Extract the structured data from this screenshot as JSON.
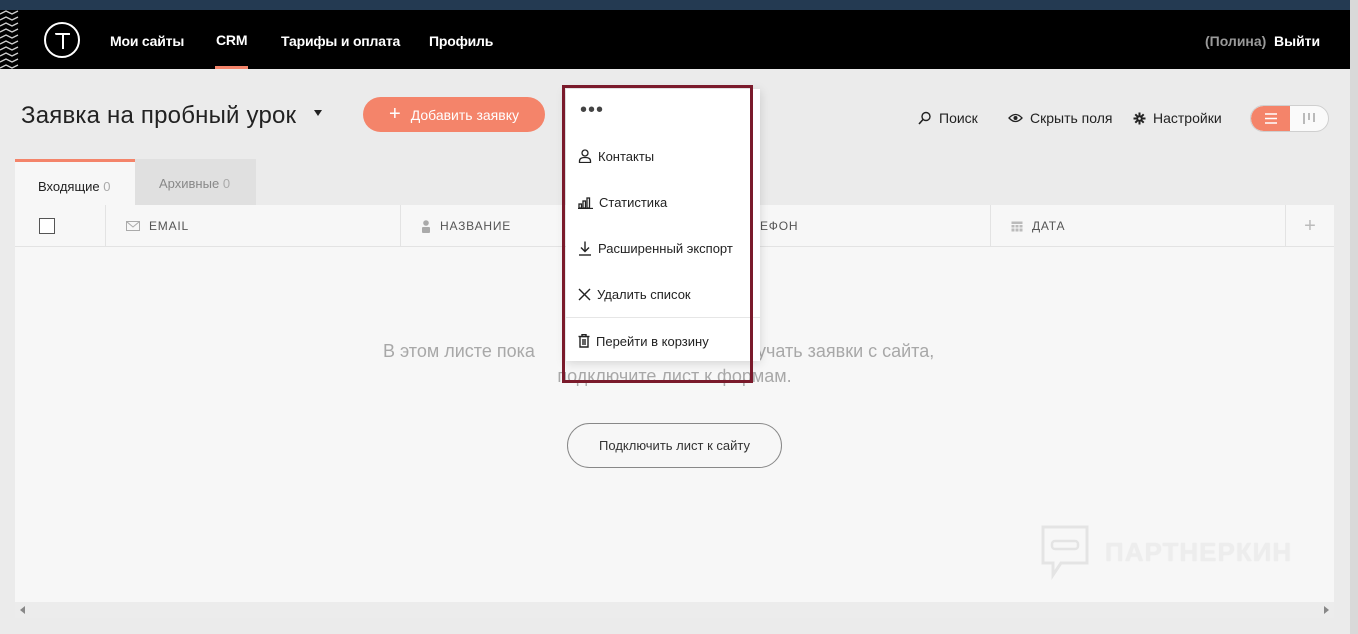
{
  "nav": {
    "logo_letter": "T",
    "items": [
      "Мои сайты",
      "CRM",
      "Тарифы и оплата",
      "Профиль"
    ],
    "active": "CRM",
    "user": "(Полина)",
    "logout": "Выйти"
  },
  "header": {
    "title": "Заявка на пробный урок",
    "add_button": "Добавить заявку",
    "tools": {
      "search": "Поиск",
      "hide_fields": "Скрыть поля",
      "settings": "Настройки"
    }
  },
  "tabs": [
    {
      "label": "Входящие",
      "count": "0"
    },
    {
      "label": "Архивные",
      "count": "0"
    }
  ],
  "columns": [
    "EMAIL",
    "НАЗВАНИЕ",
    "ЕФОН",
    "ДАТА"
  ],
  "empty": {
    "line1": "В этом листе пока",
    "line1_right": "учать заявки с сайта,",
    "line2": "подключите лист к формам.",
    "connect_button": "Подключить лист к сайту"
  },
  "menu": {
    "dots": "•••",
    "items": [
      "Контакты",
      "Статистика",
      "Расширенный экспорт",
      "Удалить список",
      "Перейти в корзину"
    ]
  },
  "watermark": "ПАРТНЕРКИН",
  "colors": {
    "accent": "#f4846a",
    "highlight": "#7a1a2b",
    "topbar": "#000000"
  }
}
